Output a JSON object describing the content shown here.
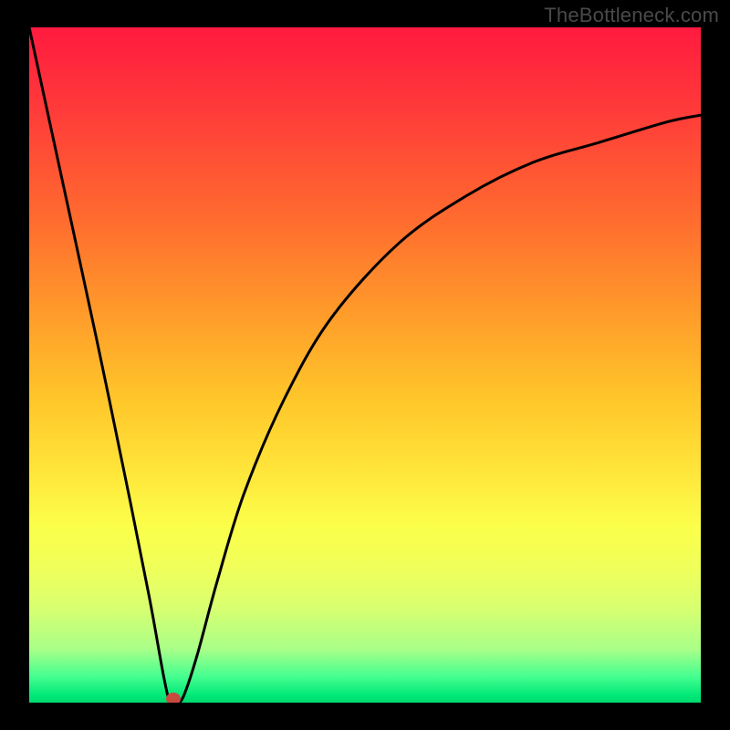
{
  "watermark": "TheBottleneck.com",
  "chart_data": {
    "type": "line",
    "title": "",
    "xlabel": "",
    "ylabel": "",
    "xlim": [
      0,
      1
    ],
    "ylim": [
      0,
      1
    ],
    "x": [
      0.0,
      0.05,
      0.1,
      0.15,
      0.18,
      0.2,
      0.21,
      0.22,
      0.23,
      0.25,
      0.28,
      0.32,
      0.38,
      0.45,
      0.55,
      0.65,
      0.75,
      0.85,
      0.95,
      1.0
    ],
    "values": [
      1.0,
      0.77,
      0.54,
      0.3,
      0.15,
      0.04,
      0.0,
      0.0,
      0.01,
      0.07,
      0.18,
      0.31,
      0.45,
      0.57,
      0.68,
      0.75,
      0.8,
      0.83,
      0.86,
      0.87
    ],
    "marker": {
      "x": 0.215,
      "y": 0.0
    },
    "colors": {
      "line": "#000000",
      "marker": "#c84a3f",
      "gradient_top": "#ff1a3f",
      "gradient_bottom": "#00d86f"
    },
    "grid": false,
    "legend": false
  }
}
